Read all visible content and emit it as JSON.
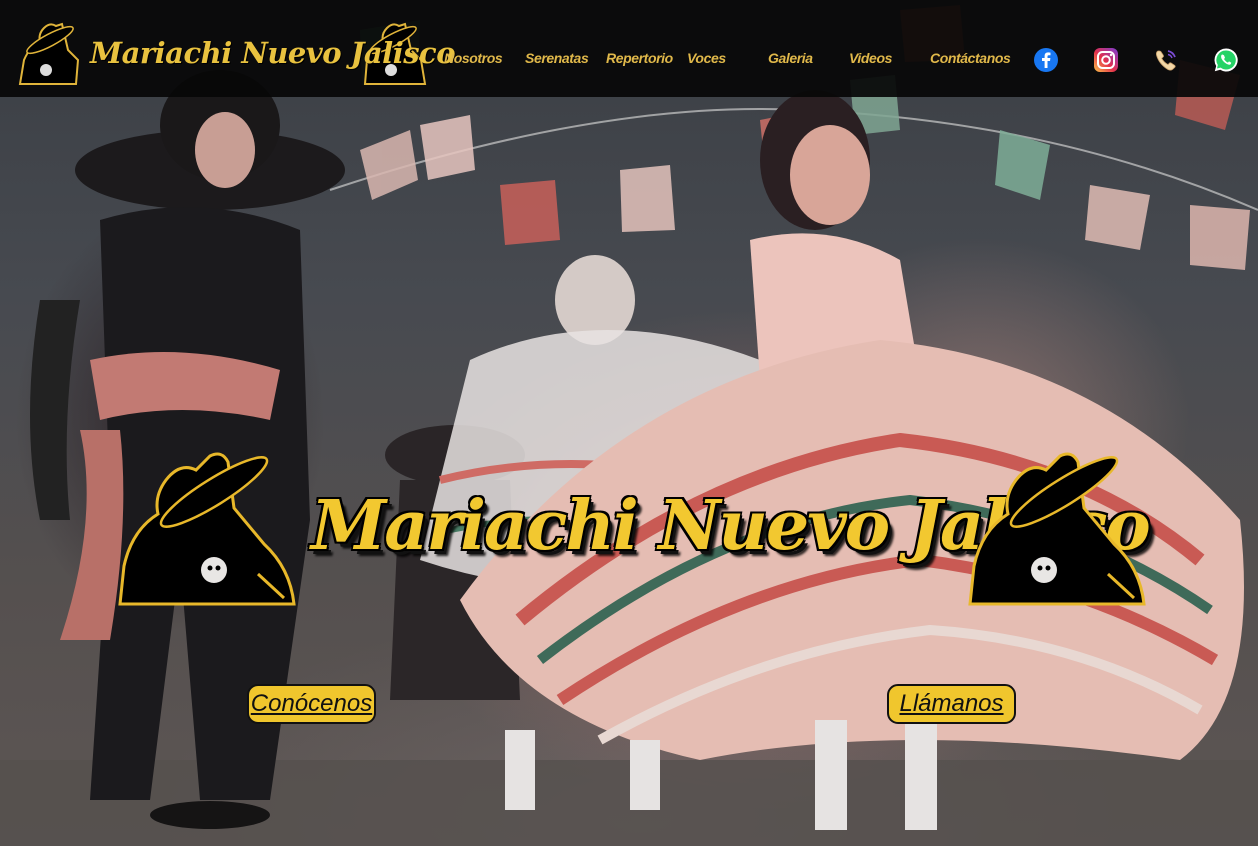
{
  "header": {
    "logo_text": "Mariachi Nuevo Jalisco",
    "nav": [
      {
        "label": "Nosotros"
      },
      {
        "label": "Serenatas"
      },
      {
        "label": "Repertorio"
      },
      {
        "label": "Voces"
      },
      {
        "label": "Galeria"
      },
      {
        "label": "Videos"
      },
      {
        "label": "Contáctanos"
      }
    ],
    "social_icons": [
      "facebook-icon",
      "instagram-icon",
      "phone-icon",
      "whatsapp-icon"
    ]
  },
  "hero": {
    "logo_title": "Mariachi Nuevo Jalisco",
    "buttons": {
      "conocenos": "Conócenos",
      "llamanos": "Llámanos"
    }
  },
  "colors": {
    "gold": "#f0c62d",
    "nav_gold": "#e0b84a",
    "header_bg": "#080808"
  }
}
